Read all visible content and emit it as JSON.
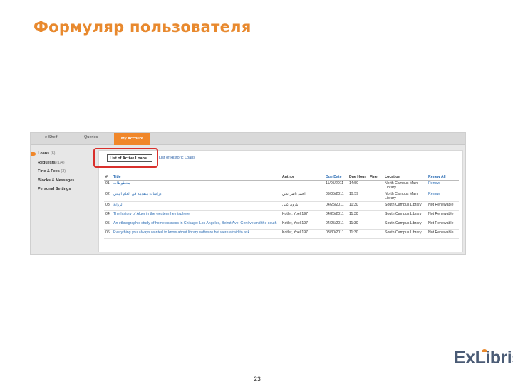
{
  "slide": {
    "title": "Формуляр пользователя",
    "page_number": "23",
    "logo_text": "ExLibris"
  },
  "tabs": [
    "e-Shelf",
    "Queries",
    "My Account"
  ],
  "sidebar": {
    "items": [
      {
        "label": "Loans",
        "count": "(6)"
      },
      {
        "label": "Requests",
        "count": "(1/4)"
      },
      {
        "label": "Fine & Fees",
        "count": "(3)"
      },
      {
        "label": "Blocks & Messages",
        "count": ""
      },
      {
        "label": "Personal Settings",
        "count": ""
      }
    ]
  },
  "loans": {
    "subtab_active": "List of Active Loans",
    "subtab_other": "List of Historic Loans",
    "columns": [
      "#",
      "Title",
      "Author",
      "Due Date",
      "Due Hour",
      "Fine",
      "Location",
      "Renew All"
    ],
    "rows": [
      {
        "num": "01",
        "title": "مخطوطات",
        "author": "",
        "due_date": "11/05/2011",
        "due_hour": "14:59",
        "fine": "",
        "location": "North Campus Main Library",
        "renew": "Renew"
      },
      {
        "num": "02",
        "title": "دراسات متقدمة في العلم البيئي",
        "author": "احمد ناصر علي",
        "due_date": "09/05/2011",
        "due_hour": "19:59",
        "fine": "",
        "location": "North Campus Main Library",
        "renew": "Renew"
      },
      {
        "num": "03",
        "title": "الرواية",
        "author": "بارون علي",
        "due_date": "04/25/2011",
        "due_hour": "11:30",
        "fine": "",
        "location": "South Campus Library",
        "renew": "Not Renewable"
      },
      {
        "num": "04",
        "title": "The history of Alger in the western hemisphere",
        "author": "Kotler, Yoel 197",
        "due_date": "04/25/2011",
        "due_hour": "11:30",
        "fine": "",
        "location": "South Campus Library",
        "renew": "Not Renewable"
      },
      {
        "num": "05",
        "title": "An ethnographic study of homelessness in Chicago: Los Angeles, Beirut Ave. Genève and the south",
        "author": "Kotler, Yoel 197",
        "due_date": "04/25/2011",
        "due_hour": "11:30",
        "fine": "",
        "location": "South Campus Library",
        "renew": "Not Renewable"
      },
      {
        "num": "06",
        "title": "Everything you always wanted to know about library software but were afraid to ask",
        "author": "Kotler, Yoel 197",
        "due_date": "03/30/2011",
        "due_hour": "11:30",
        "fine": "",
        "location": "South Campus Library",
        "renew": "Not Renewable"
      }
    ]
  },
  "colors": {
    "title": "#e8892e",
    "accent_tab": "#f0872a",
    "link": "#2f6fb5",
    "highlight": "#d9302c",
    "logo": "#4a5b75"
  }
}
